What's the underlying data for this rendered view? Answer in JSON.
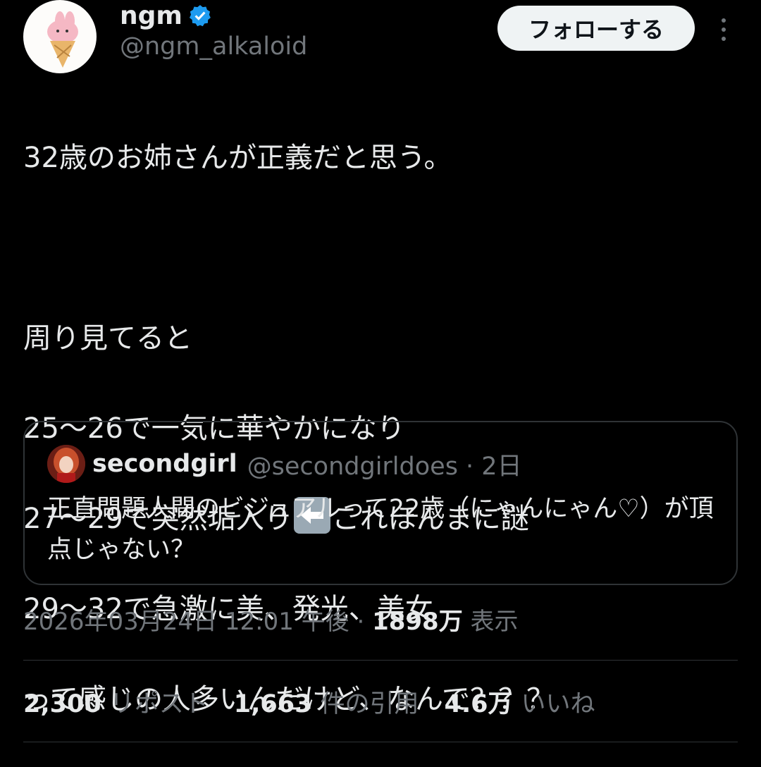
{
  "author": {
    "display_name": "ngm",
    "handle": "@ngm_alkaloid",
    "verified_icon": "verified-badge-icon",
    "verified_color": "#1d9bf0"
  },
  "follow_button": {
    "label": "フォローする"
  },
  "more_icon": "more-vertical-icon",
  "tweet": {
    "line1": "32歳のお姉さんが正義だと思う。",
    "line2": "周り見てると",
    "line3": "25〜26で一気に華やかになり",
    "line4a": "27〜29で突然垢入り",
    "line4_emoji": "left-arrow-emoji",
    "line4b": "これほんまに謎",
    "line5": "29〜32で急激に美、発光、美女",
    "line6": "って感じの人多いんだけど、なんで？？？"
  },
  "quote": {
    "display_name": "secondgirl",
    "handle_time": "@secondgirldoes · 2日",
    "text": "正直問題人間のビジュアルって22歳（にゃんにゃん♡）が頂点じゃない？"
  },
  "meta": {
    "timestamp": "2026年03月24日 12:01 午後 · ",
    "views_count": "1898万",
    "views_label": " 表示"
  },
  "stats": [
    {
      "count": "2,300",
      "label": "リポスト"
    },
    {
      "count": "1,663",
      "label": "件の引用"
    },
    {
      "count": "4.6万",
      "label": "いいね"
    }
  ]
}
